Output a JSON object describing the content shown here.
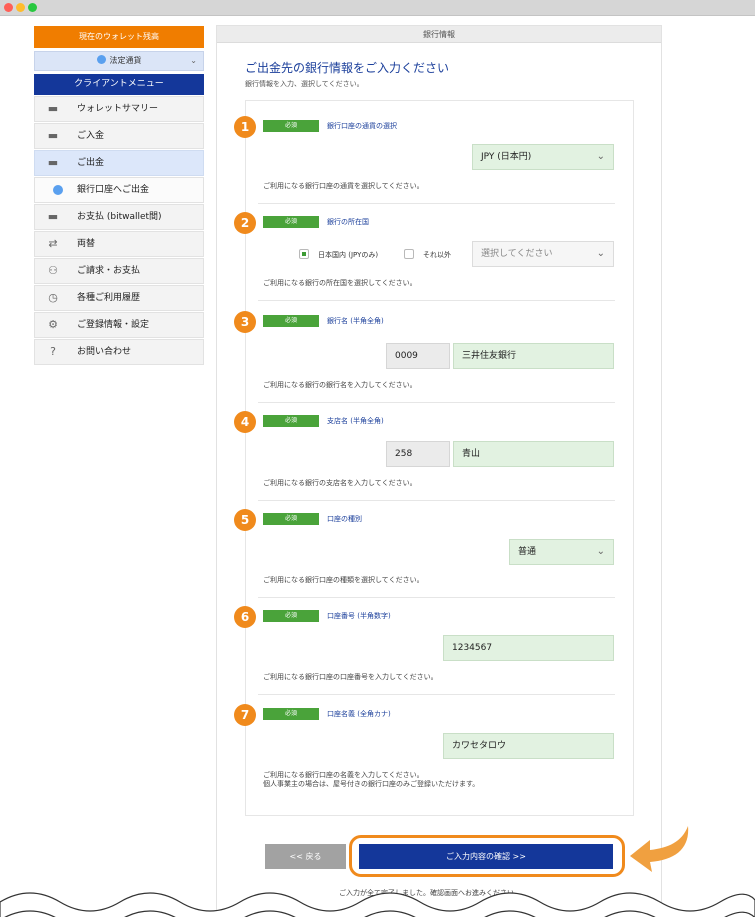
{
  "sidebar": {
    "wallet_header": "現在のウォレット残高",
    "currency_select": "法定通貨",
    "menu_header": "クライアントメニュー",
    "items": [
      {
        "label": "ウォレットサマリー",
        "icon": "wallet-icon"
      },
      {
        "label": "ご入金",
        "icon": "deposit-icon"
      },
      {
        "label": "ご出金",
        "icon": "withdraw-icon"
      },
      {
        "label": "銀行口座へご出金",
        "icon": "coin-icon"
      },
      {
        "label": "お支払 (bitwallet間)",
        "icon": "payment-icon"
      },
      {
        "label": "両替",
        "icon": "exchange-icon"
      },
      {
        "label": "ご請求・お支払",
        "icon": "users-icon"
      },
      {
        "label": "各種ご利用履歴",
        "icon": "history-icon"
      },
      {
        "label": "ご登録情報・設定",
        "icon": "gear-icon"
      },
      {
        "label": "お問い合わせ",
        "icon": "help-icon"
      }
    ]
  },
  "main": {
    "header": "銀行情報",
    "title": "ご出金先の銀行情報をご入力ください",
    "subtitle": "銀行情報を入力、選択してください。",
    "required_badge": "必須",
    "fields": [
      {
        "step": "1",
        "label": "銀行口座の通貨の選択",
        "value": "JPY (日本円)",
        "help": "ご利用になる銀行口座の通貨を選択してください。"
      },
      {
        "step": "2",
        "label": "銀行の所在国",
        "radio_domestic": "日本国内 (JPYのみ)",
        "radio_other": "それ以外",
        "placeholder": "選択してください",
        "help": "ご利用になる銀行の所在国を選択してください。"
      },
      {
        "step": "3",
        "label": "銀行名 (半角全角)",
        "code": "0009",
        "value": "三井住友銀行",
        "help": "ご利用になる銀行の銀行名を入力してください。"
      },
      {
        "step": "4",
        "label": "支店名 (半角全角)",
        "code": "258",
        "value": "青山",
        "help": "ご利用になる銀行の支店名を入力してください。"
      },
      {
        "step": "5",
        "label": "口座の種別",
        "value": "普通",
        "help": "ご利用になる銀行口座の種類を選択してください。"
      },
      {
        "step": "6",
        "label": "口座番号 (半角数字)",
        "value": "1234567",
        "help": "ご利用になる銀行口座の口座番号を入力してください。"
      },
      {
        "step": "7",
        "label": "口座名義 (全角カナ)",
        "value": "カワセタロウ",
        "help": "ご利用になる銀行口座の名義を入力してください。",
        "help2": "個人事業主の場合は、屋号付きの銀行口座のみご登録いただけます。"
      }
    ],
    "back_button": "<< 戻る",
    "confirm_button": "ご入力内容の確認 >>",
    "footnote": "ご入力が全て完了しました。確認画面へお進みください。"
  },
  "colors": {
    "brand_orange": "#f07d00",
    "brand_navy": "#14379a",
    "required_green": "#4aa33a",
    "step_orange": "#f08a1c"
  }
}
